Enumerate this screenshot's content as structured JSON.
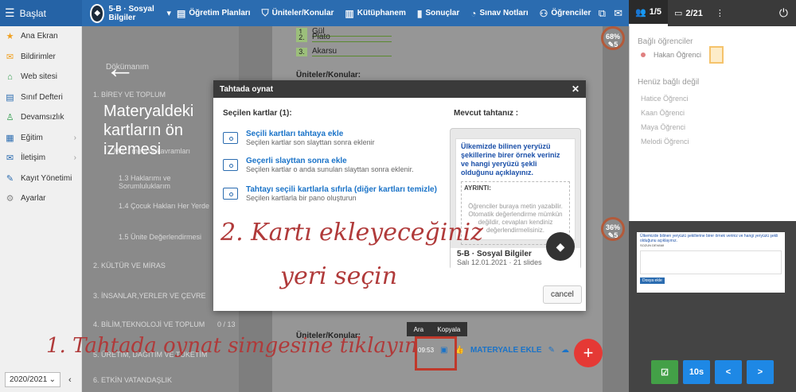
{
  "topbar": {
    "brand": "Başlat",
    "class_name": "5-B · Sosyal Bilgiler",
    "nav": [
      {
        "icon": "desk-icon",
        "label": "Öğretim Planları"
      },
      {
        "icon": "shield-icon",
        "label": "Üniteler/Konular"
      },
      {
        "icon": "library-icon",
        "label": "Kütüphanem"
      },
      {
        "icon": "chart-icon",
        "label": "Sonuçlar"
      },
      {
        "icon": "gauge-icon",
        "label": "Sınav Notları"
      },
      {
        "icon": "students-icon",
        "label": "Öğrenciler"
      }
    ]
  },
  "rightbar": {
    "students_count": "1/5",
    "pages_count": "2/21"
  },
  "sidebar": {
    "items": [
      {
        "icon": "star-icon",
        "label": "Ana Ekran",
        "arrow": false
      },
      {
        "icon": "mail-icon",
        "label": "Bildirimler",
        "arrow": false
      },
      {
        "icon": "home-icon",
        "label": "Web sitesi",
        "arrow": false
      },
      {
        "icon": "book-icon",
        "label": "Sınıf Defteri",
        "arrow": false
      },
      {
        "icon": "user-icon",
        "label": "Devamsızlık",
        "arrow": false
      },
      {
        "icon": "education-icon",
        "label": "Eğitim",
        "arrow": true
      },
      {
        "icon": "chat-icon",
        "label": "İletişim",
        "arrow": true
      },
      {
        "icon": "edit-icon",
        "label": "Kayıt Yönetimi",
        "arrow": false
      },
      {
        "icon": "gear-icon",
        "label": "Ayarlar",
        "arrow": false
      }
    ],
    "year": "2020/2021"
  },
  "middle": {
    "rows": [
      "1. BİREY VE TOPLUM",
      "1.3  Haklarımı ve Sorumluluklarım",
      "1.4  Çocuk Hakları Her Yerde",
      "1.5  Ünite Değerlendirmesi",
      "2. KÜLTÜR VE MİRAS",
      "3. İNSANLAR,YERLER VE ÇEVRE",
      "4. BİLİM,TEKNOLOJİ VE TOPLUM",
      "5. ÜRETİM, DAĞITIM VE TÜKETİM",
      "6. ETKİN VATANDAŞLIK"
    ],
    "partial_tab": "Dökümanım",
    "partial_row": "Mo... mevcut kavramları",
    "bilim_pages": "0 / 13",
    "arrow": "←",
    "overlay_title": "Materyaldeki kartların ön izlemesi"
  },
  "content": {
    "options": [
      {
        "num": "1.",
        "text": "Gül"
      },
      {
        "num": "2.",
        "text": "Plato"
      },
      {
        "num": "3.",
        "text": "Akarsu"
      }
    ],
    "unit_label_1": "Üniteler/Konular:",
    "unit_label_2": "Üniteler/Konular:",
    "badges": [
      {
        "pct": "68%",
        "sub": "5"
      },
      {
        "pct": "36%",
        "sub": "5"
      }
    ],
    "action_time": "09:53",
    "materyale_ekle": "MATERYALE EKLE"
  },
  "tooltip": {
    "a": "Ara",
    "b": "Kopyala"
  },
  "dialog": {
    "title": "Tahtada oynat",
    "selected": "Seçilen kartlar (1):",
    "current": "Mevcut tahtanız :",
    "choices": [
      {
        "title": "Seçili kartları tahtaya ekle",
        "desc": "Seçilen kartlar son slayttan sonra eklenir"
      },
      {
        "title": "Geçerli slayttan sonra ekle",
        "desc": "Seçilen kartlar o anda sunulan slayttan sonra eklenir."
      },
      {
        "title": "Tahtayı seçili kartlarla sıfırla (diğer kartları temizle)",
        "desc": "Seçilen kartlarla bir pano oluşturun"
      }
    ],
    "board_q": "Ülkemizde bilinen yeryüzü şekillerine birer örnek veriniz ve hangi yeryüzü şekli olduğunu açıklayınız.",
    "board_label": "AYRINTI:",
    "board_placeholder": "Öğrenciler buraya metin yazabilir. Otomatik değerlendirme mümkün değildir, cevapları kendiniz değerlendirmelisiniz.",
    "board_title": "5-B · Sosyal Bilgiler",
    "board_sub": "Salı 12.01.2021 · 21 slides",
    "cancel": "cancel"
  },
  "rpanel": {
    "connected": "Bağlı öğrenciler",
    "user": "Hakan Öğrenci",
    "not_connected": "Henüz bağlı değil",
    "others": [
      "Hatice Öğrenci",
      "Kaan Öğrenci",
      "Maya Öğrenci",
      "Melodi Öğrenci"
    ]
  },
  "preview": {
    "q": "Ülkemizde bilinen yeryüzü şekillerine birer örnek veriniz ve hangi yeryüzü şekli olduğunu açıklayınız.",
    "label": "SOZUN DEVAMI",
    "btn": "Dosya ekle"
  },
  "rbottom": {
    "timer": "10s",
    "prev": "<",
    "next": ">"
  },
  "annotations": {
    "step1": "1. Tahtada oynat simgesine tıklayın",
    "step2a": "2. Kartı ekleyeceğiniz",
    "step2b": "yeri seçin"
  },
  "colors": {
    "topbar": "#2b6cb0",
    "accent": "#1a73c8",
    "fab": "#e53935",
    "green": "#43a047"
  }
}
